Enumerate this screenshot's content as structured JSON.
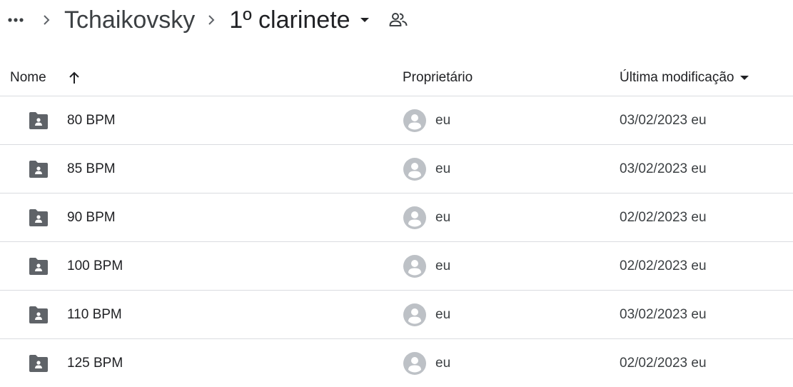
{
  "breadcrumb": {
    "more_icon": "more-horizontal-icon",
    "separator_icon": "chevron-right-icon",
    "parent": "Tchaikovsky",
    "current": "1º clarinete",
    "caret_icon": "arrow-drop-down-icon",
    "shared_icon": "shared-people-icon"
  },
  "table": {
    "headers": {
      "name": "Nome",
      "sort_icon": "arrow-up-icon",
      "owner": "Proprietário",
      "modified": "Última modificação",
      "modified_caret_icon": "arrow-drop-down-icon"
    },
    "rows": [
      {
        "name": "80 BPM",
        "icon": "shared-folder-icon",
        "owner": "eu",
        "modified": "03/02/2023 eu"
      },
      {
        "name": "85 BPM",
        "icon": "shared-folder-icon",
        "owner": "eu",
        "modified": "03/02/2023 eu"
      },
      {
        "name": "90 BPM",
        "icon": "shared-folder-icon",
        "owner": "eu",
        "modified": "02/02/2023 eu"
      },
      {
        "name": "100 BPM",
        "icon": "shared-folder-icon",
        "owner": "eu",
        "modified": "02/02/2023 eu"
      },
      {
        "name": "110 BPM",
        "icon": "shared-folder-icon",
        "owner": "eu",
        "modified": "03/02/2023 eu"
      },
      {
        "name": "125 BPM",
        "icon": "shared-folder-icon",
        "owner": "eu",
        "modified": "02/02/2023 eu"
      }
    ]
  },
  "colors": {
    "text_primary": "#202124",
    "text_secondary": "#3c4043",
    "icon_gray": "#5f6368",
    "avatar_gray": "#bdc1c6",
    "divider": "#dadce0"
  }
}
